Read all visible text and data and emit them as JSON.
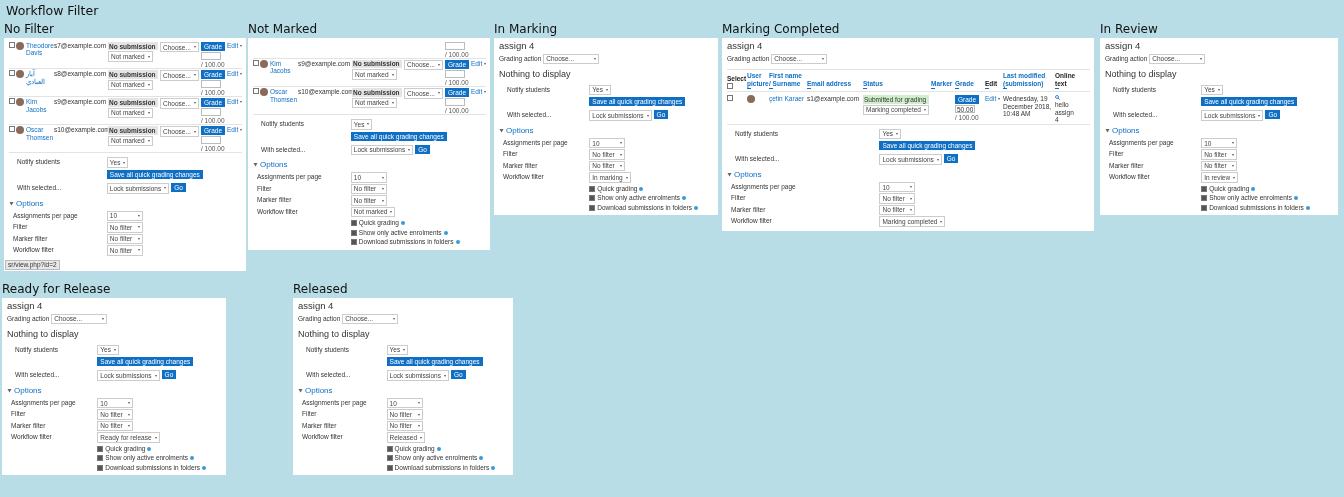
{
  "title": "Workflow Filter",
  "panels": [
    {
      "heading": "No Filter",
      "rows": [
        {
          "name": "Theodore Davis",
          "selected": false,
          "email": "s7@example.com",
          "status": "No submission",
          "submitted": false,
          "marking": "Not marked",
          "grade_action": "Choose...",
          "grade_button": "Grade",
          "grade_out_of": "/ 100.00",
          "edit": "Edit"
        },
        {
          "name": "آيار العبادي",
          "selected": false,
          "email": "s8@example.com",
          "status": "No submission",
          "submitted": false,
          "marking": "Not marked",
          "grade_action": "Choose...",
          "grade_button": "Grade",
          "grade_out_of": "/ 100.00",
          "edit": "Edit"
        },
        {
          "name": "Kim Jacobs",
          "selected": false,
          "email": "s9@example.com",
          "status": "No submission",
          "submitted": false,
          "marking": "Not marked",
          "grade_action": "Choose...",
          "grade_button": "Grade",
          "grade_out_of": "/ 100.00",
          "edit": "Edit"
        },
        {
          "name": "Oscar Thomsen",
          "selected": false,
          "email": "s10@example.com",
          "status": "No submission",
          "submitted": false,
          "marking": "Not marked",
          "grade_action": "Choose...",
          "grade_button": "Grade",
          "grade_out_of": "/ 100.00",
          "edit": "Edit"
        }
      ],
      "notify": {
        "label": "Notify students",
        "value": "Yes"
      },
      "save_button": "Save all quick grading changes",
      "with_selected": {
        "label": "With selected...",
        "value": "Lock submissions",
        "button": "Go"
      },
      "options": {
        "title": "Options",
        "expanded": true,
        "fields": [
          {
            "label": "Assignments per page",
            "value": "10"
          },
          {
            "label": "Filter",
            "value": "No filter"
          },
          {
            "label": "Marker filter",
            "value": "No filter"
          },
          {
            "label": "Workflow filter",
            "value": "No filter"
          }
        ]
      },
      "status_bar": "sr/view.php?id=2"
    },
    {
      "heading": "Not Marked",
      "rows": [
        {
          "grade_out_of": "/ 100.00"
        },
        {
          "name": "Kim Jacobs",
          "selected": false,
          "email": "s9@example.com",
          "status": "No submission",
          "submitted": false,
          "marking": "Not marked",
          "grade_action": "Choose...",
          "grade_button": "Grade",
          "grade_out_of": "/ 100.00",
          "edit": "Edit"
        },
        {
          "name": "Oscar Thomsen",
          "selected": false,
          "email": "s10@example.com",
          "status": "No submission",
          "submitted": false,
          "marking": "Not marked",
          "grade_action": "Choose...",
          "grade_button": "Grade",
          "grade_out_of": "/ 100.00",
          "edit": "Edit"
        }
      ],
      "notify": {
        "label": "Notify students",
        "value": "Yes"
      },
      "save_button": "Save all quick grading changes",
      "with_selected": {
        "label": "With selected...",
        "value": "Lock submissions",
        "button": "Go"
      },
      "options": {
        "title": "Options",
        "expanded": true,
        "fields": [
          {
            "label": "Assignments per page",
            "value": "10"
          },
          {
            "label": "Filter",
            "value": "No filter"
          },
          {
            "label": "Marker filter",
            "value": "No filter"
          },
          {
            "label": "Workflow filter",
            "value": "Not marked"
          }
        ],
        "checkboxes": [
          {
            "label": "Quick grading",
            "checked": true
          },
          {
            "label": "Show only active enrolments",
            "checked": true
          },
          {
            "label": "Download submissions in folders",
            "checked": true
          }
        ]
      }
    },
    {
      "heading": "In Marking",
      "assignment": "assign 4",
      "grading_action": {
        "label": "Grading action",
        "value": "Choose..."
      },
      "message": "Nothing to display",
      "notify": {
        "label": "Notify students",
        "value": "Yes"
      },
      "save_button": "Save all quick grading changes",
      "with_selected": {
        "label": "With selected...",
        "value": "Lock submissions",
        "button": "Go"
      },
      "options": {
        "title": "Options",
        "expanded": true,
        "fields": [
          {
            "label": "Assignments per page",
            "value": "10"
          },
          {
            "label": "Filter",
            "value": "No filter"
          },
          {
            "label": "Marker filter",
            "value": "No filter"
          },
          {
            "label": "Workflow filter",
            "value": "In marking"
          }
        ],
        "checkboxes": [
          {
            "label": "Quick grading",
            "checked": true
          },
          {
            "label": "Show only active enrolments",
            "checked": true
          },
          {
            "label": "Download submissions in folders",
            "checked": true
          }
        ]
      }
    },
    {
      "heading": "Marking Completed",
      "assignment": "assign 4",
      "grading_action": {
        "label": "Grading action",
        "value": "Choose..."
      },
      "select_all_checked": false,
      "columns": [
        {
          "label": "Select",
          "link": false
        },
        {
          "label": "User picture",
          "link": true
        },
        {
          "label": "First name / Surname",
          "link": true
        },
        {
          "label": "Email address",
          "link": true
        },
        {
          "label": "Status",
          "link": true
        },
        {
          "label": "Marker",
          "link": true
        },
        {
          "label": "Grade",
          "link": true
        },
        {
          "label": "Edit",
          "link": false
        },
        {
          "label": "Last modified (submission)",
          "link": true
        },
        {
          "label": "Online text",
          "link": false
        }
      ],
      "rows": [
        {
          "name": "çetin Karaer",
          "selected": false,
          "email": "s1@example.com",
          "status": "Submitted for grading",
          "submitted": true,
          "marking": "Marking completed",
          "grade_button": "Grade",
          "grade_value": "50.00",
          "grade_out_of": "/ 100.00",
          "edit": "Edit",
          "last_modified": "Wednesday, 19 December 2018, 10:48 AM",
          "online_text": "hello assign 4"
        }
      ],
      "notify": {
        "label": "Notify students",
        "value": "Yes"
      },
      "save_button": "Save all quick grading changes",
      "with_selected": {
        "label": "With selected...",
        "value": "Lock submissions",
        "button": "Go"
      },
      "options": {
        "title": "Options",
        "expanded": true,
        "fields": [
          {
            "label": "Assignments per page",
            "value": "10"
          },
          {
            "label": "Filter",
            "value": "No filter"
          },
          {
            "label": "Marker filter",
            "value": "No filter"
          },
          {
            "label": "Workflow filter",
            "value": "Marking completed"
          }
        ]
      }
    },
    {
      "heading": "In Review",
      "assignment": "assign 4",
      "grading_action": {
        "label": "Grading action",
        "value": "Choose..."
      },
      "message": "Nothing to display",
      "notify": {
        "label": "Notify students",
        "value": "Yes"
      },
      "save_button": "Save all quick grading changes",
      "with_selected": {
        "label": "With selected...",
        "value": "Lock submissions",
        "button": "Go"
      },
      "options": {
        "title": "Options",
        "expanded": true,
        "fields": [
          {
            "label": "Assignments per page",
            "value": "10"
          },
          {
            "label": "Filter",
            "value": "No filter"
          },
          {
            "label": "Marker filter",
            "value": "No filter"
          },
          {
            "label": "Workflow filter",
            "value": "In review"
          }
        ],
        "checkboxes": [
          {
            "label": "Quick grading",
            "checked": true
          },
          {
            "label": "Show only active enrolments",
            "checked": true
          },
          {
            "label": "Download submissions in folders",
            "checked": true
          }
        ]
      }
    },
    {
      "heading": "Ready for Release",
      "assignment": "assign 4",
      "grading_action": {
        "label": "Grading action",
        "value": "Choose..."
      },
      "message": "Nothing to display",
      "notify": {
        "label": "Notify students",
        "value": "Yes"
      },
      "save_button": "Save all quick grading changes",
      "with_selected": {
        "label": "With selected...",
        "value": "Lock submissions",
        "button": "Go"
      },
      "options": {
        "title": "Options",
        "expanded": true,
        "fields": [
          {
            "label": "Assignments per page",
            "value": "10"
          },
          {
            "label": "Filter",
            "value": "No filter"
          },
          {
            "label": "Marker filter",
            "value": "No filter"
          },
          {
            "label": "Workflow filter",
            "value": "Ready for release"
          }
        ],
        "checkboxes": [
          {
            "label": "Quick grading",
            "checked": true
          },
          {
            "label": "Show only active enrolments",
            "checked": true
          },
          {
            "label": "Download submissions in folders",
            "checked": true
          }
        ]
      }
    },
    {
      "heading": "Released",
      "assignment": "assign 4",
      "grading_action": {
        "label": "Grading action",
        "value": "Choose..."
      },
      "message": "Nothing to display",
      "notify": {
        "label": "Notify students",
        "value": "Yes"
      },
      "save_button": "Save all quick grading changes",
      "with_selected": {
        "label": "With selected...",
        "value": "Lock submissions",
        "button": "Go"
      },
      "options": {
        "title": "Options",
        "expanded": true,
        "fields": [
          {
            "label": "Assignments per page",
            "value": "10"
          },
          {
            "label": "Filter",
            "value": "No filter"
          },
          {
            "label": "Marker filter",
            "value": "No filter"
          },
          {
            "label": "Workflow filter",
            "value": "Released"
          }
        ],
        "checkboxes": [
          {
            "label": "Quick grading",
            "checked": true
          },
          {
            "label": "Show only active enrolments",
            "checked": true
          },
          {
            "label": "Download submissions in folders",
            "checked": true
          }
        ]
      }
    }
  ]
}
